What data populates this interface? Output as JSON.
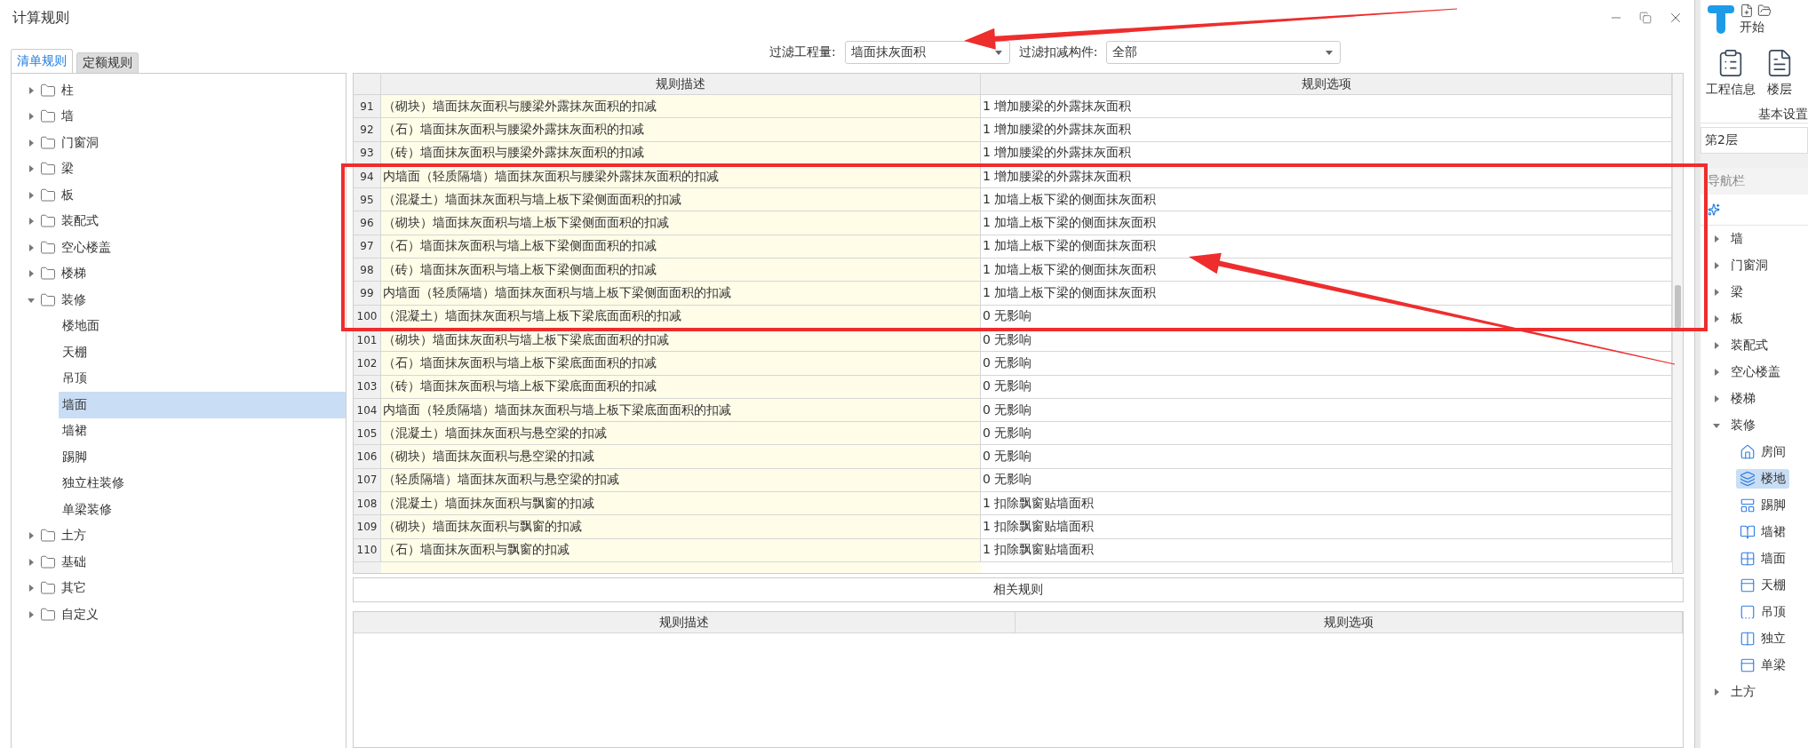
{
  "window": {
    "title": "计算规则"
  },
  "tabs": [
    {
      "label": "清单规则",
      "selected": true
    },
    {
      "label": "定额规则",
      "selected": false
    }
  ],
  "filters": [
    {
      "label": "过滤工程量:",
      "value": "墙面抹灰面积"
    },
    {
      "label": "过滤扣减构件:",
      "value": "全部"
    }
  ],
  "tree": [
    {
      "label": "柱",
      "expanded": false,
      "selected": false
    },
    {
      "label": "墙",
      "expanded": false,
      "selected": false
    },
    {
      "label": "门窗洞",
      "expanded": false,
      "selected": false
    },
    {
      "label": "梁",
      "expanded": false,
      "selected": false
    },
    {
      "label": "板",
      "expanded": false,
      "selected": false
    },
    {
      "label": "装配式",
      "expanded": false,
      "selected": false
    },
    {
      "label": "空心楼盖",
      "expanded": false,
      "selected": false
    },
    {
      "label": "楼梯",
      "expanded": false,
      "selected": false
    },
    {
      "label": "装修",
      "expanded": true,
      "selected": false,
      "children": [
        {
          "label": "楼地面",
          "selected": false
        },
        {
          "label": "天棚",
          "selected": false
        },
        {
          "label": "吊顶",
          "selected": false
        },
        {
          "label": "墙面",
          "selected": true
        },
        {
          "label": "墙裙",
          "selected": false
        },
        {
          "label": "踢脚",
          "selected": false
        },
        {
          "label": "独立柱装修",
          "selected": false
        },
        {
          "label": "单梁装修",
          "selected": false
        }
      ]
    },
    {
      "label": "土方",
      "expanded": false,
      "selected": false
    },
    {
      "label": "基础",
      "expanded": false,
      "selected": false
    },
    {
      "label": "其它",
      "expanded": false,
      "selected": false
    },
    {
      "label": "自定义",
      "expanded": false,
      "selected": false
    }
  ],
  "rules_table": {
    "columns": [
      "规则描述",
      "规则选项"
    ],
    "rows": [
      {
        "index": "91",
        "description": "（砌块）墙面抹灰面积与腰梁外露抹灰面积的扣减",
        "option": "1 增加腰梁的外露抹灰面积"
      },
      {
        "index": "92",
        "description": "（石）墙面抹灰面积与腰梁外露抹灰面积的扣减",
        "option": "1 增加腰梁的外露抹灰面积"
      },
      {
        "index": "93",
        "description": "（砖）墙面抹灰面积与腰梁外露抹灰面积的扣减",
        "option": "1 增加腰梁的外露抹灰面积"
      },
      {
        "index": "94",
        "description": "内墙面（轻质隔墙）墙面抹灰面积与腰梁外露抹灰面积的扣减",
        "option": "1 增加腰梁的外露抹灰面积"
      },
      {
        "index": "95",
        "description": "（混凝土）墙面抹灰面积与墙上板下梁侧面面积的扣减",
        "option": "1 加墙上板下梁的侧面抹灰面积"
      },
      {
        "index": "96",
        "description": "（砌块）墙面抹灰面积与墙上板下梁侧面面积的扣减",
        "option": "1 加墙上板下梁的侧面抹灰面积"
      },
      {
        "index": "97",
        "description": "（石）墙面抹灰面积与墙上板下梁侧面面积的扣减",
        "option": "1 加墙上板下梁的侧面抹灰面积"
      },
      {
        "index": "98",
        "description": "（砖）墙面抹灰面积与墙上板下梁侧面面积的扣减",
        "option": "1 加墙上板下梁的侧面抹灰面积"
      },
      {
        "index": "99",
        "description": "内墙面（轻质隔墙）墙面抹灰面积与墙上板下梁侧面面积的扣减",
        "option": "1 加墙上板下梁的侧面抹灰面积"
      },
      {
        "index": "100",
        "description": "（混凝土）墙面抹灰面积与墙上板下梁底面面积的扣减",
        "option": "0 无影响"
      },
      {
        "index": "101",
        "description": "（砌块）墙面抹灰面积与墙上板下梁底面面积的扣减",
        "option": "0 无影响"
      },
      {
        "index": "102",
        "description": "（石）墙面抹灰面积与墙上板下梁底面面积的扣减",
        "option": "0 无影响"
      },
      {
        "index": "103",
        "description": "（砖）墙面抹灰面积与墙上板下梁底面面积的扣减",
        "option": "0 无影响"
      },
      {
        "index": "104",
        "description": "内墙面（轻质隔墙）墙面抹灰面积与墙上板下梁底面面积的扣减",
        "option": "0 无影响"
      },
      {
        "index": "105",
        "description": "（混凝土）墙面抹灰面积与悬空梁的扣减",
        "option": "0 无影响"
      },
      {
        "index": "106",
        "description": "（砌块）墙面抹灰面积与悬空梁的扣减",
        "option": "0 无影响"
      },
      {
        "index": "107",
        "description": "（轻质隔墙）墙面抹灰面积与悬空梁的扣减",
        "option": "0 无影响"
      },
      {
        "index": "108",
        "description": "（混凝土）墙面抹灰面积与飘窗的扣减",
        "option": "1 扣除飘窗贴墙面积"
      },
      {
        "index": "109",
        "description": "（砌块）墙面抹灰面积与飘窗的扣减",
        "option": "1 扣除飘窗贴墙面积"
      },
      {
        "index": "110",
        "description": "（石）墙面抹灰面积与飘窗的扣减",
        "option": "1 扣除飘窗贴墙面积"
      }
    ]
  },
  "related": {
    "title": "相关规则",
    "columns": [
      "规则描述",
      "规则选项"
    ]
  },
  "app_panel": {
    "ribbon_tab": "开始",
    "buttons": [
      {
        "label": "工程信息"
      },
      {
        "label": "楼层"
      }
    ],
    "group_label": "基本设置",
    "floor": "第2层",
    "nav_title": "导航栏",
    "nav": [
      {
        "label": "墙",
        "expanded": false
      },
      {
        "label": "门窗洞",
        "expanded": false
      },
      {
        "label": "梁",
        "expanded": false
      },
      {
        "label": "板",
        "expanded": false
      },
      {
        "label": "装配式",
        "expanded": false
      },
      {
        "label": "空心楼盖",
        "expanded": false
      },
      {
        "label": "楼梯",
        "expanded": false
      },
      {
        "label": "装修",
        "expanded": true,
        "children": [
          {
            "label": "房间",
            "selected": false
          },
          {
            "label": "楼地",
            "selected": true
          },
          {
            "label": "踢脚",
            "selected": false
          },
          {
            "label": "墙裙",
            "selected": false
          },
          {
            "label": "墙面",
            "selected": false
          },
          {
            "label": "天棚",
            "selected": false
          },
          {
            "label": "吊顶",
            "selected": false
          },
          {
            "label": "独立",
            "selected": false
          },
          {
            "label": "单梁",
            "selected": false
          }
        ]
      },
      {
        "label": "土方",
        "expanded": false
      }
    ]
  },
  "annotations": [
    {
      "kind": "frame"
    },
    {
      "kind": "arrow"
    },
    {
      "kind": "arrow"
    }
  ]
}
